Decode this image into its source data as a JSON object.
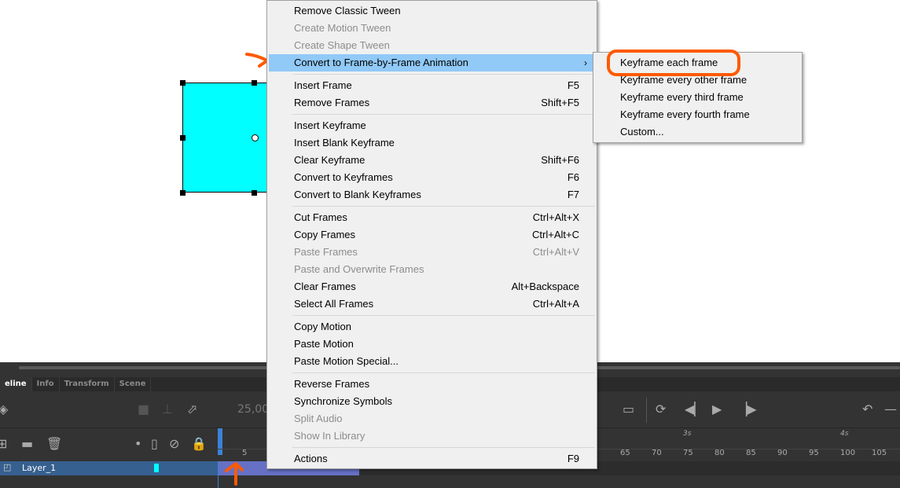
{
  "menu": {
    "items": [
      {
        "label": "Remove Classic Tween",
        "shortcut": "",
        "disabled": false
      },
      {
        "label": "Create Motion Tween",
        "shortcut": "",
        "disabled": true
      },
      {
        "label": "Create Shape Tween",
        "shortcut": "",
        "disabled": true
      },
      {
        "label": "Convert to Frame-by-Frame Animation",
        "shortcut": "",
        "disabled": false,
        "submenu": true,
        "highlighted": true
      },
      {
        "label": "Insert Frame",
        "shortcut": "F5",
        "disabled": false
      },
      {
        "label": "Remove Frames",
        "shortcut": "Shift+F5",
        "disabled": false
      },
      {
        "label": "Insert Keyframe",
        "shortcut": "",
        "disabled": false
      },
      {
        "label": "Insert Blank Keyframe",
        "shortcut": "",
        "disabled": false
      },
      {
        "label": "Clear Keyframe",
        "shortcut": "Shift+F6",
        "disabled": false
      },
      {
        "label": "Convert to Keyframes",
        "shortcut": "F6",
        "disabled": false
      },
      {
        "label": "Convert to Blank Keyframes",
        "shortcut": "F7",
        "disabled": false
      },
      {
        "label": "Cut Frames",
        "shortcut": "Ctrl+Alt+X",
        "disabled": false
      },
      {
        "label": "Copy Frames",
        "shortcut": "Ctrl+Alt+C",
        "disabled": false
      },
      {
        "label": "Paste Frames",
        "shortcut": "Ctrl+Alt+V",
        "disabled": true
      },
      {
        "label": "Paste and Overwrite Frames",
        "shortcut": "",
        "disabled": true
      },
      {
        "label": "Clear Frames",
        "shortcut": "Alt+Backspace",
        "disabled": false
      },
      {
        "label": "Select All Frames",
        "shortcut": "Ctrl+Alt+A",
        "disabled": false
      },
      {
        "label": "Copy Motion",
        "shortcut": "",
        "disabled": false
      },
      {
        "label": "Paste Motion",
        "shortcut": "",
        "disabled": false
      },
      {
        "label": "Paste Motion Special...",
        "shortcut": "",
        "disabled": false
      },
      {
        "label": "Reverse Frames",
        "shortcut": "",
        "disabled": false
      },
      {
        "label": "Synchronize Symbols",
        "shortcut": "",
        "disabled": false
      },
      {
        "label": "Split Audio",
        "shortcut": "",
        "disabled": true
      },
      {
        "label": "Show In Library",
        "shortcut": "",
        "disabled": true
      },
      {
        "label": "Actions",
        "shortcut": "F9",
        "disabled": false
      }
    ],
    "submenu_arrow": "›"
  },
  "submenu": {
    "items": [
      "Keyframe each frame",
      "Keyframe every other frame",
      "Keyframe every third frame",
      "Keyframe every fourth frame",
      "Custom..."
    ]
  },
  "timeline": {
    "tabs": [
      "eline",
      "Info",
      "Transform",
      "Scene"
    ],
    "fps": "25,00",
    "layer_name": "Layer_1",
    "ruler_labels": [
      "5",
      "65",
      "70",
      "75",
      "80",
      "85",
      "90",
      "95",
      "100",
      "105"
    ],
    "seconds_labels": [
      "3s",
      "4s"
    ]
  },
  "colors": {
    "shape_fill": "#00ffff",
    "highlight": "#91c9f7",
    "annotation": "#ff5a00",
    "layer_selected": "#36608f"
  }
}
